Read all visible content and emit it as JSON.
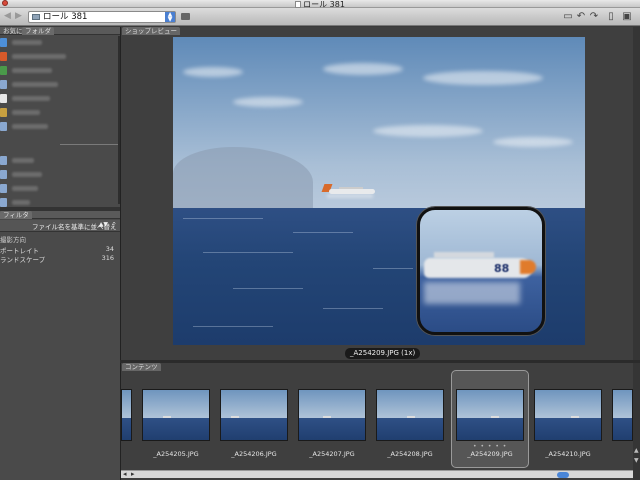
{
  "window": {
    "title": "ロール 381"
  },
  "toolbar": {
    "back_icon": "chevron-left-icon",
    "forward_icon": "chevron-right-icon",
    "path": "ロール 381",
    "right_icons": [
      "open-folder-icon",
      "rotate-left-icon",
      "rotate-right-icon",
      "trash-icon",
      "camera-icon"
    ]
  },
  "left": {
    "tabs": [
      "お気に入り",
      "フォルダ"
    ],
    "filter_tab": "フィルタ",
    "sort_label": "ファイル名を基準に並べ替え",
    "filter_heading": "撮影方向",
    "filters": [
      {
        "label": "ポートレイト",
        "count": "34"
      },
      {
        "label": "ランドスケープ",
        "count": "316"
      }
    ]
  },
  "preview": {
    "tab": "ショップレビュー",
    "caption": "_A254209.JPG (1x)",
    "loupe_number": "88"
  },
  "content": {
    "tab": "コンテンツ",
    "thumbnails": [
      {
        "label": "_A254205.JPG"
      },
      {
        "label": "_A254206.JPG"
      },
      {
        "label": "_A254207.JPG"
      },
      {
        "label": "_A254208.JPG"
      },
      {
        "label": "_A254209.JPG",
        "selected": true
      },
      {
        "label": "_A254210.JPG"
      }
    ],
    "selected_dots": "• • • • •"
  },
  "colors": {
    "accent": "#4a7fd1",
    "panel": "#4a4a4a",
    "background": "#3f3f3f"
  }
}
